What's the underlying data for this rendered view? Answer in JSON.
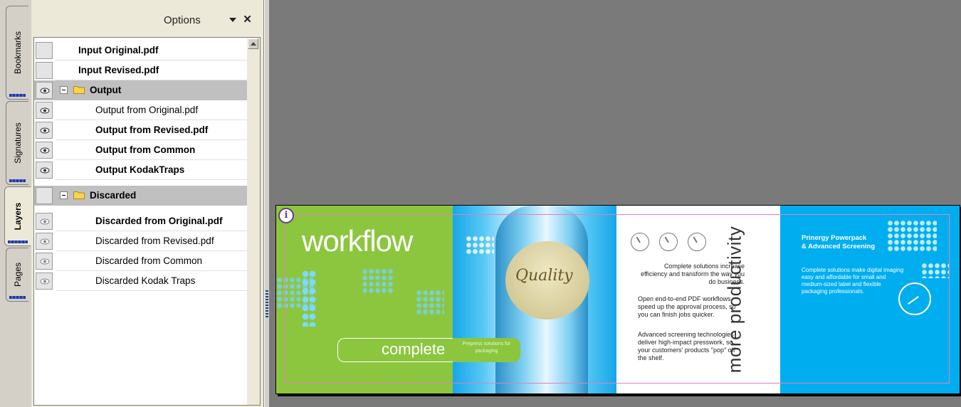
{
  "tabs": [
    {
      "label": "Bookmarks",
      "active": false
    },
    {
      "label": "Signatures",
      "active": false
    },
    {
      "label": "Layers",
      "active": true
    },
    {
      "label": "Pages",
      "active": false
    }
  ],
  "panel": {
    "options_label": "Options",
    "close_glyph": "×"
  },
  "layers": [
    {
      "name": "Input Original.pdf",
      "visible": false,
      "bold": true,
      "level": 0
    },
    {
      "name": "Input Revised.pdf",
      "visible": false,
      "bold": true,
      "level": 0
    },
    {
      "name": "Output",
      "visible": true,
      "bold": true,
      "group": true,
      "expanded": true
    },
    {
      "name": "Output from Original.pdf",
      "visible": true,
      "bold": false,
      "level": 1
    },
    {
      "name": "Output from Revised.pdf",
      "visible": true,
      "bold": true,
      "level": 1
    },
    {
      "name": "Output from Common",
      "visible": true,
      "bold": true,
      "level": 1
    },
    {
      "name": "Output KodakTraps",
      "visible": true,
      "bold": true,
      "level": 1
    },
    {
      "name": "Discarded",
      "visible": false,
      "bold": true,
      "group": true,
      "expanded": true
    },
    {
      "name": "Discarded from Original.pdf",
      "visible": true,
      "bold": true,
      "level": 1
    },
    {
      "name": "Discarded from Revised.pdf",
      "visible": true,
      "bold": false,
      "level": 1
    },
    {
      "name": "Discarded from Common",
      "visible": true,
      "bold": false,
      "level": 1
    },
    {
      "name": "Discarded Kodak Traps",
      "visible": true,
      "bold": false,
      "level": 1
    }
  ],
  "document": {
    "info_glyph": "i",
    "workflow": "workflow",
    "complete": "complete",
    "prepress": "Prepress solutions for packaging",
    "quality": "Quality",
    "more_productivity": "more productivity",
    "para1": "Complete solutions increase efficiency and transform the way you do business.",
    "para2": "Open end-to-end PDF workflows speed up the approval process, so you can finish jobs quicker.",
    "para3": "Advanced screening technologies deliver high-impact presswork, so your customers' products \"pop\" off the shelf.",
    "prinergy_line1": "Prinergy Powerpack",
    "prinergy_line2": "& Advanced Screening",
    "complete_solutions": "Complete solutions make digital imaging easy and affordable for small and medium-sized label and flexible packaging professionals."
  },
  "colors": {
    "green": "#8cc63f",
    "cyan": "#00aeef",
    "accent_tab": "#233a9a"
  }
}
